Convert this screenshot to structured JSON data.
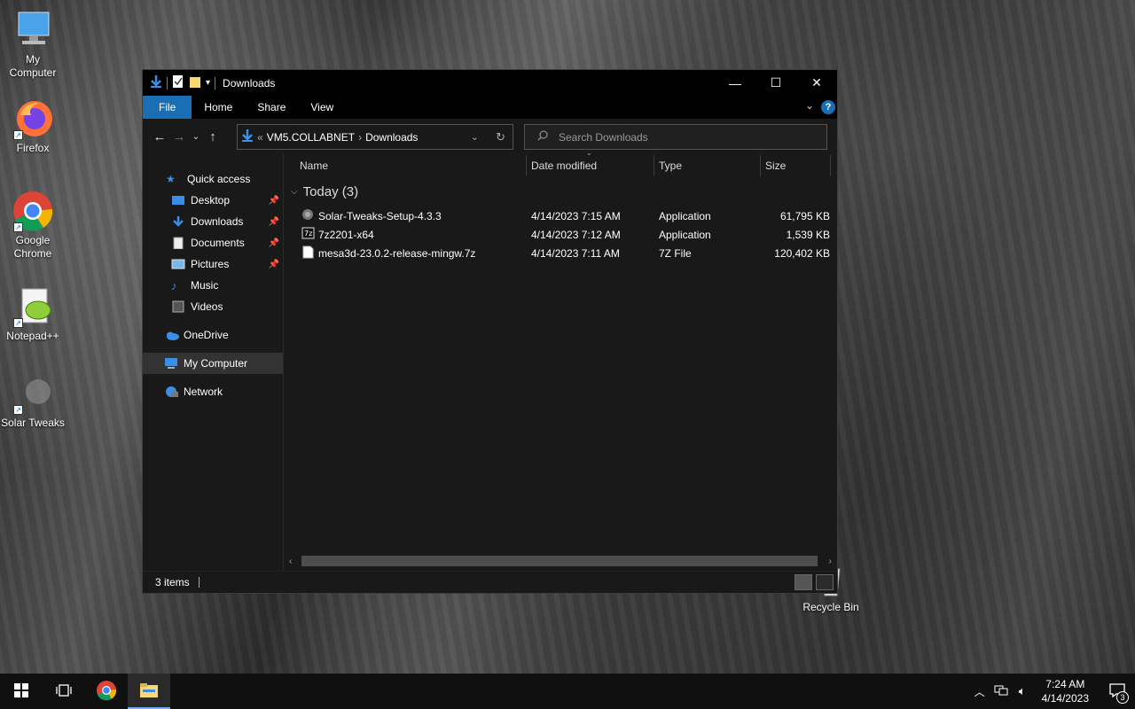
{
  "desktop": {
    "icons": [
      {
        "label_line1": "My",
        "label_line2": "Computer"
      },
      {
        "label_line1": "Firefox",
        "label_line2": ""
      },
      {
        "label_line1": "Google",
        "label_line2": "Chrome"
      },
      {
        "label_line1": "Notepad++",
        "label_line2": ""
      },
      {
        "label_line1": "Solar Tweaks",
        "label_line2": ""
      },
      {
        "label_line1": "Recycle Bin",
        "label_line2": ""
      }
    ]
  },
  "window": {
    "title": "Downloads",
    "controls": {
      "minimize": "—",
      "maximize": "☐",
      "close": "✕"
    },
    "ribbon_tabs": [
      "File",
      "Home",
      "Share",
      "View"
    ],
    "help": "?",
    "address": {
      "prefix": "«",
      "crumbs": [
        "VM5.COLLABNET",
        "Downloads"
      ],
      "sep": "›"
    },
    "search_placeholder": "Search Downloads",
    "nav": {
      "quick_access": "Quick access",
      "items": [
        "Desktop",
        "Downloads",
        "Documents",
        "Pictures",
        "Music",
        "Videos"
      ],
      "onedrive": "OneDrive",
      "my_computer": "My Computer",
      "network": "Network"
    },
    "columns": [
      "Name",
      "Date modified",
      "Type",
      "Size"
    ],
    "group": "Today (3)",
    "files": [
      {
        "name": "Solar-Tweaks-Setup-4.3.3",
        "date": "4/14/2023 7:15 AM",
        "type": "Application",
        "size": "61,795 KB",
        "icon": "setup-icon"
      },
      {
        "name": "7z2201-x64",
        "date": "4/14/2023 7:12 AM",
        "type": "Application",
        "size": "1,539 KB",
        "icon": "7zip-icon"
      },
      {
        "name": "mesa3d-23.0.2-release-mingw.7z",
        "date": "4/14/2023 7:11 AM",
        "type": "7Z File",
        "size": "120,402 KB",
        "icon": "file-icon"
      }
    ],
    "status": "3 items"
  },
  "taskbar": {
    "time": "7:24 AM",
    "date": "4/14/2023",
    "notifications": "3"
  },
  "colors": {
    "accent": "#1a6fb4",
    "window_bg": "#191919",
    "titlebar": "#000000"
  }
}
